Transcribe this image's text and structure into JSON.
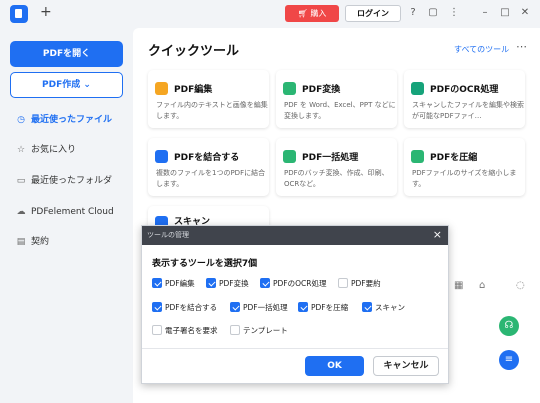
{
  "titlebar": {
    "buy_label": "購入",
    "login_label": "ログイン",
    "new_tab_glyph": "+"
  },
  "sidebar": {
    "open_label": "PDFを開く",
    "create_label": "PDF作成",
    "create_chevron": "⌄",
    "items": [
      {
        "label": "最近使ったファイル",
        "icon": "clock-icon",
        "glyph": "◷",
        "active": true
      },
      {
        "label": "お気に入り",
        "icon": "star-icon",
        "glyph": "☆",
        "active": false
      },
      {
        "label": "最近使ったフォルダ",
        "icon": "folder-icon",
        "glyph": "▭",
        "active": false
      },
      {
        "label": "PDFelement Cloud",
        "icon": "cloud-icon",
        "glyph": "☁",
        "active": false
      },
      {
        "label": "契約",
        "icon": "document-icon",
        "glyph": "▤",
        "active": false
      }
    ]
  },
  "main": {
    "title": "クイックツール",
    "all_tools": "すべてのツール",
    "more": "⋯",
    "cards": [
      {
        "title": "PDF編集",
        "desc": "ファイル内のテキストと画像を編集します。",
        "color": "#f5a623"
      },
      {
        "title": "PDF変換",
        "desc": "PDF を Word、Excel、PPT などに変換します。",
        "color": "#2bb673"
      },
      {
        "title": "PDFのOCR処理",
        "desc": "スキャンしたファイルを編集や検索が可能なPDFファイ…",
        "color": "#16a37a"
      },
      {
        "title": "PDFを結合する",
        "desc": "複数のファイルを1つのPDFに結合します。",
        "color": "#1f6ff2"
      },
      {
        "title": "PDF一括処理",
        "desc": "PDFのバッチ変換、作成、印刷、OCRなど。",
        "color": "#2bb673"
      },
      {
        "title": "PDFを圧縮",
        "desc": "PDFファイルのサイズを縮小します。",
        "color": "#2bb673"
      },
      {
        "title": "スキャン",
        "desc": "",
        "color": "#1f6ff2"
      }
    ]
  },
  "dialog": {
    "title": "ツールの管理",
    "subtitle": "表示するツールを選択7個",
    "options": [
      {
        "label": "PDF編集",
        "checked": true
      },
      {
        "label": "PDF変換",
        "checked": true
      },
      {
        "label": "PDFのOCR処理",
        "checked": true
      },
      {
        "label": "PDF要約",
        "checked": false
      },
      {
        "label": "PDFを結合する",
        "checked": true
      },
      {
        "label": "PDF一括処理",
        "checked": true
      },
      {
        "label": "PDFを圧縮",
        "checked": true
      },
      {
        "label": "スキャン",
        "checked": true
      },
      {
        "label": "電子署名を要求",
        "checked": false
      },
      {
        "label": "テンプレート",
        "checked": false
      }
    ],
    "ok_label": "OK",
    "cancel_label": "キャンセル"
  },
  "colors": {
    "accent": "#1f6ff2",
    "buy": "#f04747",
    "dialog_header": "#40444c",
    "fab_support": "#2bb673"
  }
}
